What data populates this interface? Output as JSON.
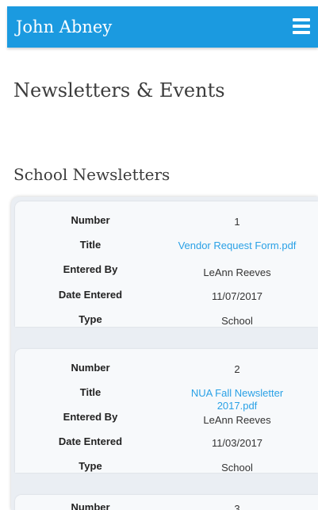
{
  "header": {
    "user_name": "John Abney",
    "menu_icon": "hamburger-menu-icon",
    "bar_color": "#1b9ae0"
  },
  "page_title": "Newsletters & Events",
  "section_title": "School Newsletters",
  "field_labels": {
    "number": "Number",
    "title": "Title",
    "entered_by": "Entered By",
    "date_entered": "Date Entered",
    "type": "Type"
  },
  "newsletters": [
    {
      "number": "1",
      "title": "Vendor Request Form.pdf",
      "entered_by": "LeAnn Reeves",
      "date_entered": "11/07/2017",
      "type": "School"
    },
    {
      "number": "2",
      "title": "NUA Fall Newsletter 2017.pdf",
      "entered_by": "LeAnn Reeves",
      "date_entered": "11/03/2017",
      "type": "School"
    },
    {
      "number": "3"
    }
  ],
  "colors": {
    "link": "#2aa1e6",
    "card_background": "#f7f9fb",
    "list_background": "#eaeef3"
  }
}
